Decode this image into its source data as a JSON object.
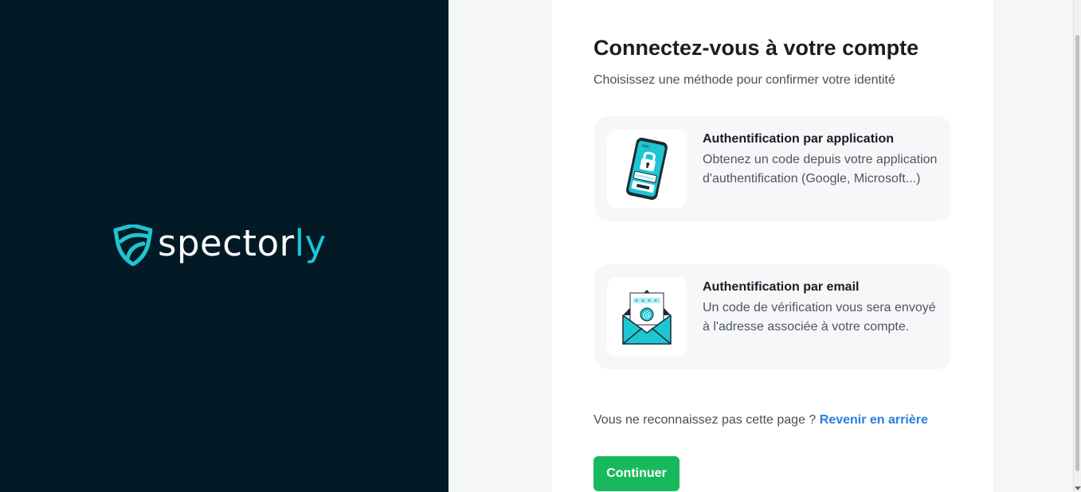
{
  "brand": {
    "name_main": "spector",
    "name_accent": "ly",
    "accent_color": "#1ec5d2",
    "background_color": "#011a26"
  },
  "login": {
    "title": "Connectez-vous à votre compte",
    "subtitle": "Choisissez une méthode pour confirmer votre identité"
  },
  "options": [
    {
      "icon": "phone-lock-icon",
      "title": "Authentification par application",
      "description": "Obtenez un code depuis votre application d'authentification (Google, Microsoft...)"
    },
    {
      "icon": "envelope-email-icon",
      "title": "Authentification par email",
      "description": "Un code de vérification vous sera envoyé à l'adresse associée à votre compte."
    }
  ],
  "back": {
    "prompt": "Vous ne reconnaissez pas cette page ?",
    "link_label": "Revenir en arrière"
  },
  "continue_label": "Continuer",
  "colors": {
    "primary_button": "#18b95c",
    "link": "#2a7ee0"
  }
}
